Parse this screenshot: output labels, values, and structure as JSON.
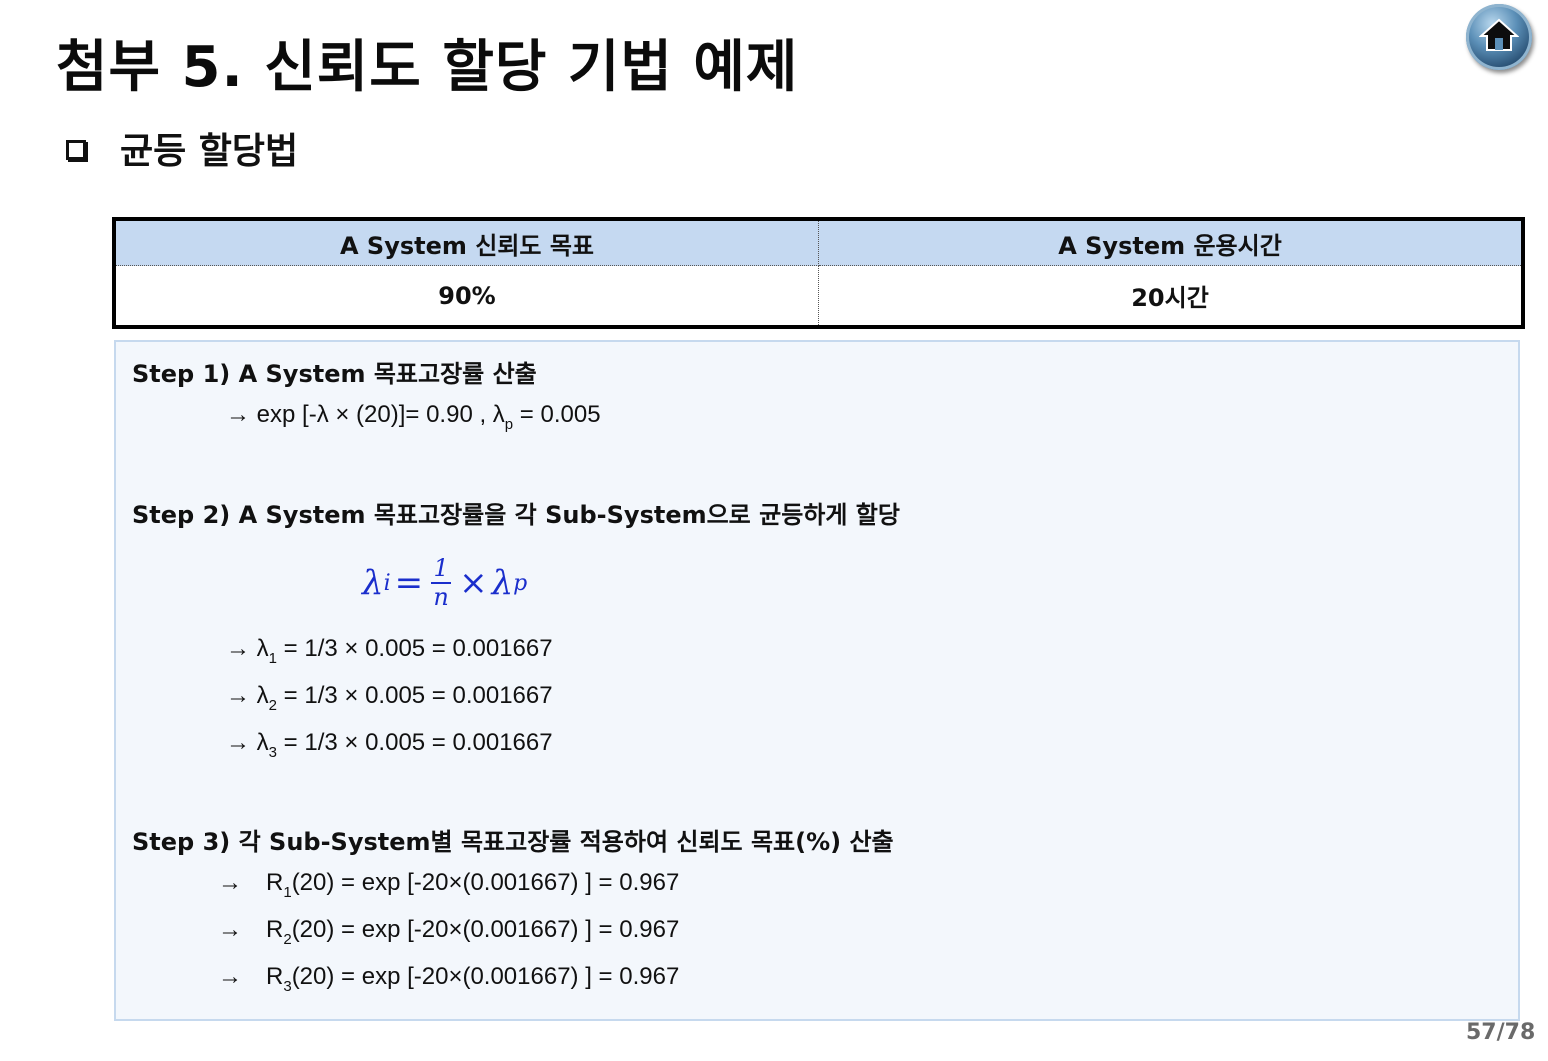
{
  "title": "첨부 5. 신뢰도 할당 기법 예제",
  "subheading": "균등 할당법",
  "table": {
    "headers": [
      "A System 신뢰도 목표",
      "A System 운용시간"
    ],
    "values": [
      "90%",
      "20시간"
    ]
  },
  "steps": {
    "step1": {
      "title": "Step 1)  A System 목표고장률 산출",
      "eq_main": "→ exp [-λ × (20)]= 0.90 , λ",
      "eq_sub": "p",
      "eq_tail": " = 0.005"
    },
    "step2": {
      "title": "Step 2) A System 목표고장률을 각 Sub-System으로 균등하게 할당",
      "formula": {
        "lhs": "λ",
        "lhs_sub": "i",
        "eq": "=",
        "num": "1",
        "den": "n",
        "times": "×",
        "rhs": "λ",
        "rhs_sub": "p"
      },
      "lines": [
        {
          "prefix": "→ λ",
          "sub": "1",
          "rest": " = 1/3 × 0.005 = 0.001667"
        },
        {
          "prefix": "→ λ",
          "sub": "2",
          "rest": " = 1/3 × 0.005 = 0.001667"
        },
        {
          "prefix": "→ λ",
          "sub": "3",
          "rest": " = 1/3 × 0.005 = 0.001667"
        }
      ]
    },
    "step3": {
      "title": "Step 3) 각 Sub-System별 목표고장률 적용하여 신뢰도 목표(%) 산출",
      "arrow": "→",
      "lines": [
        {
          "prefix": "R",
          "sub": "1",
          "rest": "(20) = exp [-20×(0.001667) ] = 0.967"
        },
        {
          "prefix": "R",
          "sub": "2",
          "rest": "(20) = exp [-20×(0.001667) ] = 0.967"
        },
        {
          "prefix": "R",
          "sub": "3",
          "rest": "(20) = exp [-20×(0.001667) ] = 0.967"
        }
      ]
    }
  },
  "page_number": "57/78",
  "icons": {
    "home": "home-icon"
  },
  "colors": {
    "table_header_bg": "#c5d9f1",
    "content_bg": "#f3f7fc",
    "formula": "#1a2ecc"
  }
}
